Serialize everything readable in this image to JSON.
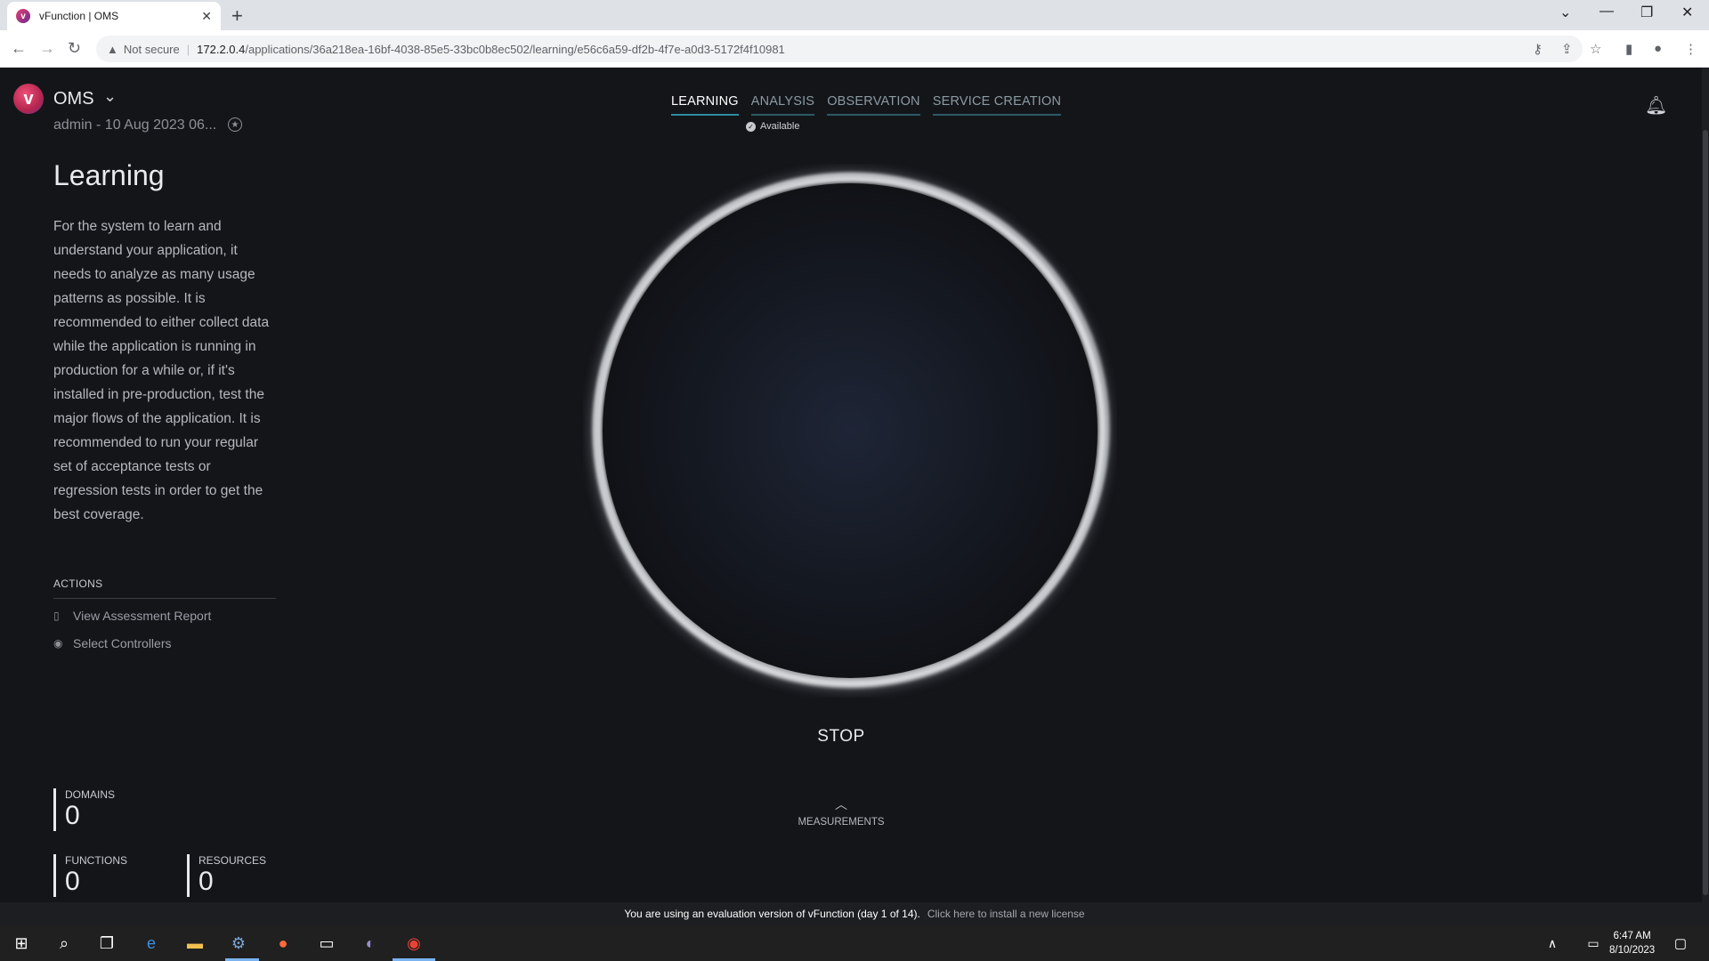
{
  "browser": {
    "tab_title": "vFunction | OMS",
    "security_label": "Not secure",
    "url_host": "172.2.0.4",
    "url_path": "/applications/36a218ea-16bf-4038-85e5-33bc0b8ec502/learning/e56c6a59-df2b-4f7e-a0d3-5172f4f10981"
  },
  "app": {
    "name": "OMS",
    "subline": "admin - 10 Aug 2023 06...",
    "tabs": [
      {
        "label": "LEARNING"
      },
      {
        "label": "ANALYSIS"
      },
      {
        "label": "OBSERVATION"
      },
      {
        "label": "SERVICE CREATION"
      }
    ],
    "status": "Available"
  },
  "sidebar": {
    "title": "Learning",
    "description": "For the system to learn and understand your application, it needs to analyze as many usage patterns as possible. It is recommended to either collect data while the application is running in production for a while or, if it's installed in pre-production, test the major flows of the application. It is recommended to run your regular set of acceptance tests or regression tests in order to get the best coverage.",
    "actions_title": "ACTIONS",
    "actions": [
      {
        "label": "View Assessment Report",
        "icon": "document-icon"
      },
      {
        "label": "Select Controllers",
        "icon": "target-icon"
      }
    ],
    "stats": {
      "domains_label": "DOMAINS",
      "domains_value": "0",
      "functions_label": "FUNCTIONS",
      "functions_value": "0",
      "resources_label": "RESOURCES",
      "resources_value": "0"
    }
  },
  "main": {
    "stop_label": "STOP",
    "measurements_label": "MEASUREMENTS"
  },
  "eval_bar": {
    "message": "You are using an evaluation version of vFunction (day 1 of 14).",
    "link": "Click here to install a new license"
  },
  "taskbar": {
    "time": "6:47 AM",
    "date": "8/10/2023"
  }
}
